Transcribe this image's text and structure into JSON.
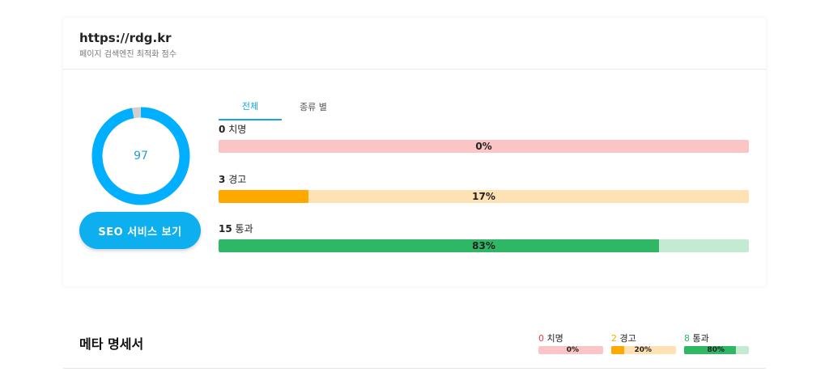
{
  "header": {
    "url": "https://rdg.kr",
    "subtitle": "페이지 검색엔진 최적화 점수"
  },
  "score": {
    "value": "97",
    "fraction": 0.97,
    "color": "#00afff",
    "track_color": "#d0d0d0"
  },
  "seo_button": {
    "label": "SEO 서비스 보기"
  },
  "tabs": [
    {
      "label": "전체",
      "active": true
    },
    {
      "label": "종류 별",
      "active": false
    }
  ],
  "metrics": [
    {
      "count": "0",
      "name": "치명",
      "percent_label": "0%",
      "percent": 0,
      "fill_color": "#e53e3e",
      "track_color": "#fcc5c5"
    },
    {
      "count": "3",
      "name": "경고",
      "percent_label": "17%",
      "percent": 17,
      "fill_color": "#ffa800",
      "track_color": "#fee2b3"
    },
    {
      "count": "15",
      "name": "통과",
      "percent_label": "83%",
      "percent": 83,
      "fill_color": "#30b765",
      "track_color": "#c4ead2"
    }
  ],
  "meta_section": {
    "title": "메타 명세서",
    "summary": [
      {
        "count": "0",
        "name": "치명",
        "percent_label": "0%",
        "percent": 0,
        "count_color": "#e53e3e",
        "fill_color": "#e53e3e",
        "track_color": "#fcc5c5"
      },
      {
        "count": "2",
        "name": "경고",
        "percent_label": "20%",
        "percent": 20,
        "count_color": "#ffa800",
        "fill_color": "#ffa800",
        "track_color": "#fee2b3"
      },
      {
        "count": "8",
        "name": "통과",
        "percent_label": "80%",
        "percent": 80,
        "count_color": "#30b765",
        "fill_color": "#30b765",
        "track_color": "#c4ead2"
      }
    ]
  }
}
